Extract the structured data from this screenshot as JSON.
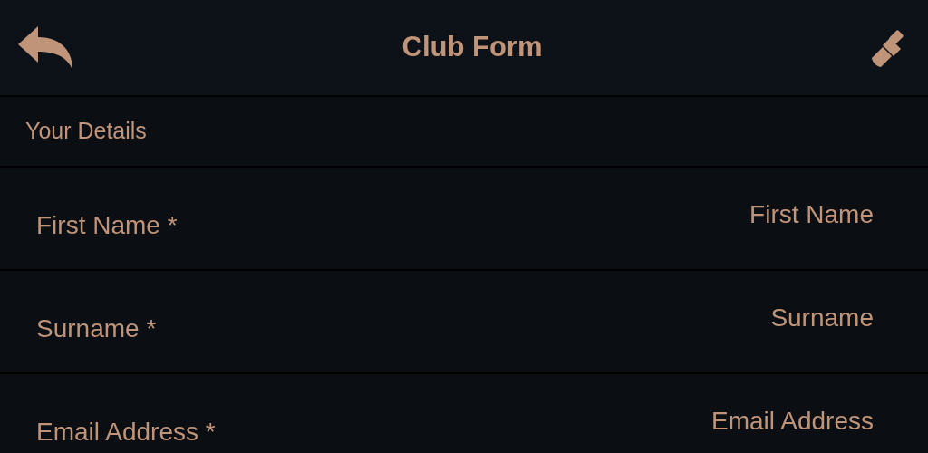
{
  "header": {
    "title": "Club Form"
  },
  "section": {
    "title": "Your Details"
  },
  "fields": [
    {
      "label": "First Name *",
      "placeholder": "First Name"
    },
    {
      "label": "Surname *",
      "placeholder": "Surname"
    },
    {
      "label": "Email Address *",
      "placeholder": "Email Address"
    }
  ]
}
